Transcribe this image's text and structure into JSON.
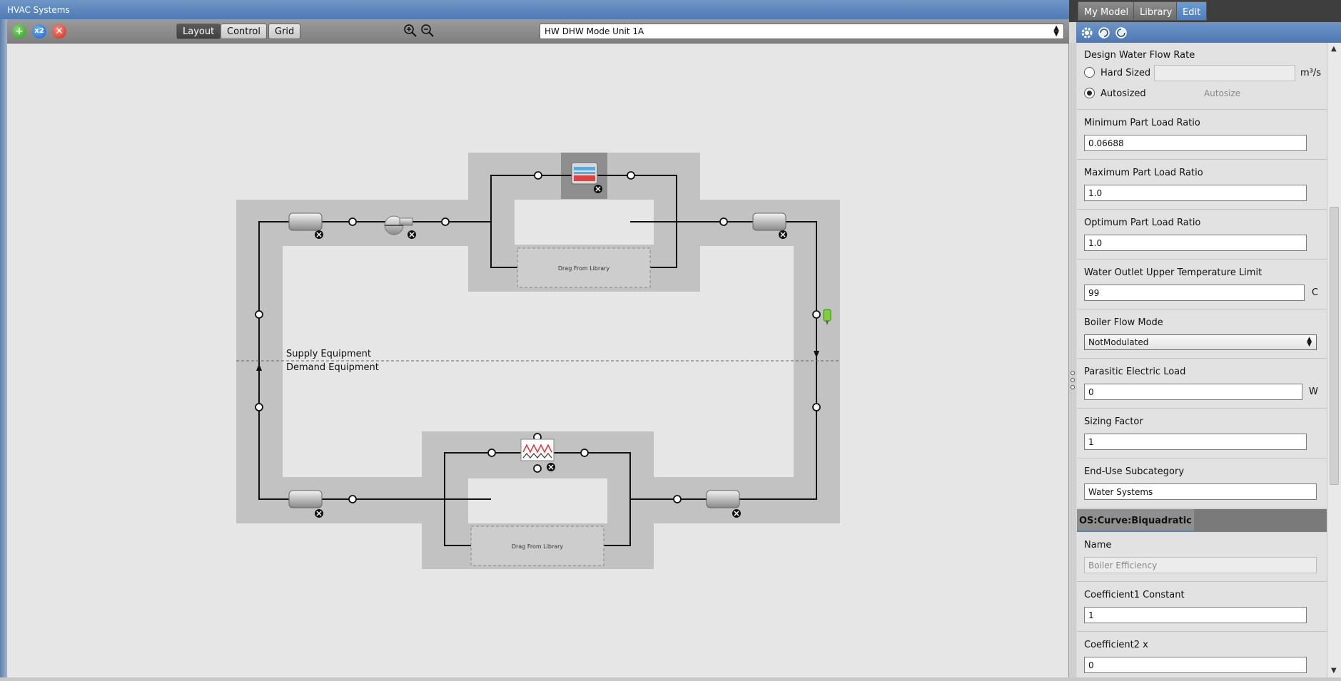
{
  "window_title": "HVAC Systems",
  "toolbar": {
    "add_icon": "plus-icon",
    "copy_icon": "x2-icon",
    "delete_icon": "x-icon",
    "buttons": [
      "Layout",
      "Control",
      "Grid"
    ],
    "active_button": "Layout",
    "zoom_in": "zoom-in-icon",
    "zoom_out": "zoom-out-icon",
    "selected_system": "HW DHW Mode Unit 1A"
  },
  "diagram": {
    "supply_label": "Supply Equipment",
    "demand_label": "Demand Equipment",
    "drop_zone_top": "Drag From Library",
    "drop_zone_bottom": "Drag From Library"
  },
  "side": {
    "tabs": [
      "My Model",
      "Library",
      "Edit"
    ],
    "active_tab": "Edit",
    "fields": {
      "design_water_flow_rate": {
        "label": "Design Water Flow Rate",
        "hard_sized_label": "Hard Sized",
        "hard_sized_value": "",
        "unit": "m³/s",
        "autosized_label": "Autosized",
        "autosize_placeholder": "Autosize"
      },
      "min_plr": {
        "label": "Minimum Part Load Ratio",
        "value": "0.06688"
      },
      "max_plr": {
        "label": "Maximum Part Load Ratio",
        "value": "1.0"
      },
      "opt_plr": {
        "label": "Optimum Part Load Ratio",
        "value": "1.0"
      },
      "outlet_temp": {
        "label": "Water Outlet Upper Temperature Limit",
        "value": "99",
        "unit": "C"
      },
      "flow_mode": {
        "label": "Boiler Flow Mode",
        "value": "NotModulated"
      },
      "parasitic": {
        "label": "Parasitic Electric Load",
        "value": "0",
        "unit": "W"
      },
      "sizing": {
        "label": "Sizing Factor",
        "value": "1"
      },
      "end_use": {
        "label": "End-Use Subcategory",
        "value": "Water Systems"
      }
    },
    "curve_section": "OS:Curve:Biquadratic",
    "curve": {
      "name": {
        "label": "Name",
        "value": "Boiler Efficiency"
      },
      "coef1": {
        "label": "Coefficient1 Constant",
        "value": "1"
      },
      "coef2": {
        "label": "Coefficient2 x",
        "value": "0"
      }
    }
  }
}
